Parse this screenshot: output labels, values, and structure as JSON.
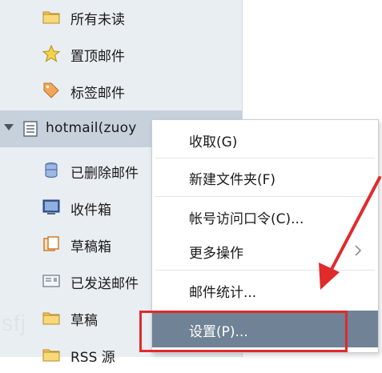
{
  "sidebar": {
    "items": [
      {
        "label": "所有未读",
        "icon": "folder-icon"
      },
      {
        "label": "置顶邮件",
        "icon": "star-icon"
      },
      {
        "label": "标签邮件",
        "icon": "tag-icon"
      }
    ],
    "account": {
      "label": "hotmail(zuoy",
      "icon": "mailbox-icon"
    },
    "folders": [
      {
        "label": "已删除邮件",
        "icon": "trash-icon"
      },
      {
        "label": "收件箱",
        "icon": "inbox-icon"
      },
      {
        "label": "草稿箱",
        "icon": "drafts-icon"
      },
      {
        "label": "已发送邮件",
        "icon": "sent-icon"
      },
      {
        "label": "草稿",
        "icon": "folder-icon"
      },
      {
        "label": "RSS 源",
        "icon": "folder-icon"
      }
    ]
  },
  "context_menu": {
    "items": [
      {
        "label": "收取(G)"
      },
      {
        "label": "新建文件夹(F)"
      },
      {
        "label": "帐号访问口令(C)..."
      },
      {
        "label": "更多操作",
        "submenu": true
      },
      {
        "label": "邮件统计..."
      },
      {
        "label": "设置(P)...",
        "highlighted": true
      }
    ]
  },
  "watermark": "sfj",
  "colors": {
    "sidebar_bg": "#e9eef3",
    "account_selected_bg": "#c6d1dc",
    "menu_highlight_bg": "#6f8296",
    "annotation_red": "#e12a2a"
  }
}
